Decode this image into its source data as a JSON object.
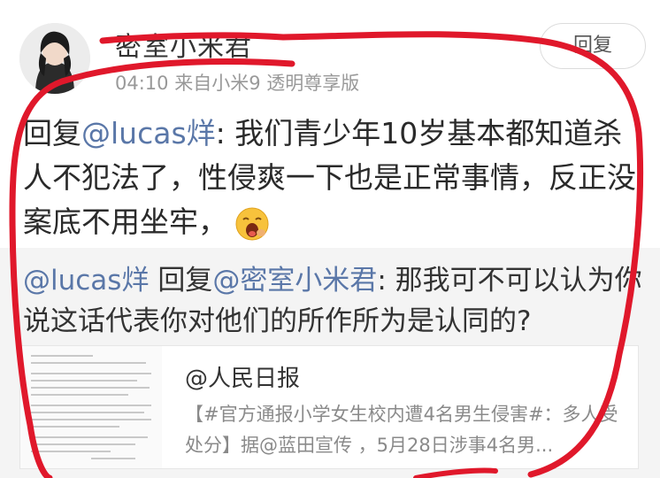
{
  "post": {
    "username": "密室小米君",
    "meta": "04:10 来自小米9 透明尊享版",
    "reply_button_label": "回复",
    "comment": {
      "prefix": "回复",
      "mention": "@lucas烊",
      "body": ": 我们青少年10岁基本都知道杀人不犯法了，性侵爽一下也是正常事情，反正没案底不用坐牢，",
      "emoji_icon": "yawning-face-icon"
    }
  },
  "quote": {
    "author_mention": "@lucas烊",
    "reply_word": "回复",
    "target_mention": "@密室小米君",
    "body": ": 那我可不可以认为你说这话代表你对他们的所作所为是认同的?"
  },
  "embed": {
    "title": "@人民日报",
    "description": "【#官方通报小学女生校内遭4名男生侵害#：多人受处分】据@蓝田宣传 ，5月28日涉事4名男..."
  },
  "colors": {
    "mention": "#5a77a8",
    "annotation": "#e0182b"
  }
}
